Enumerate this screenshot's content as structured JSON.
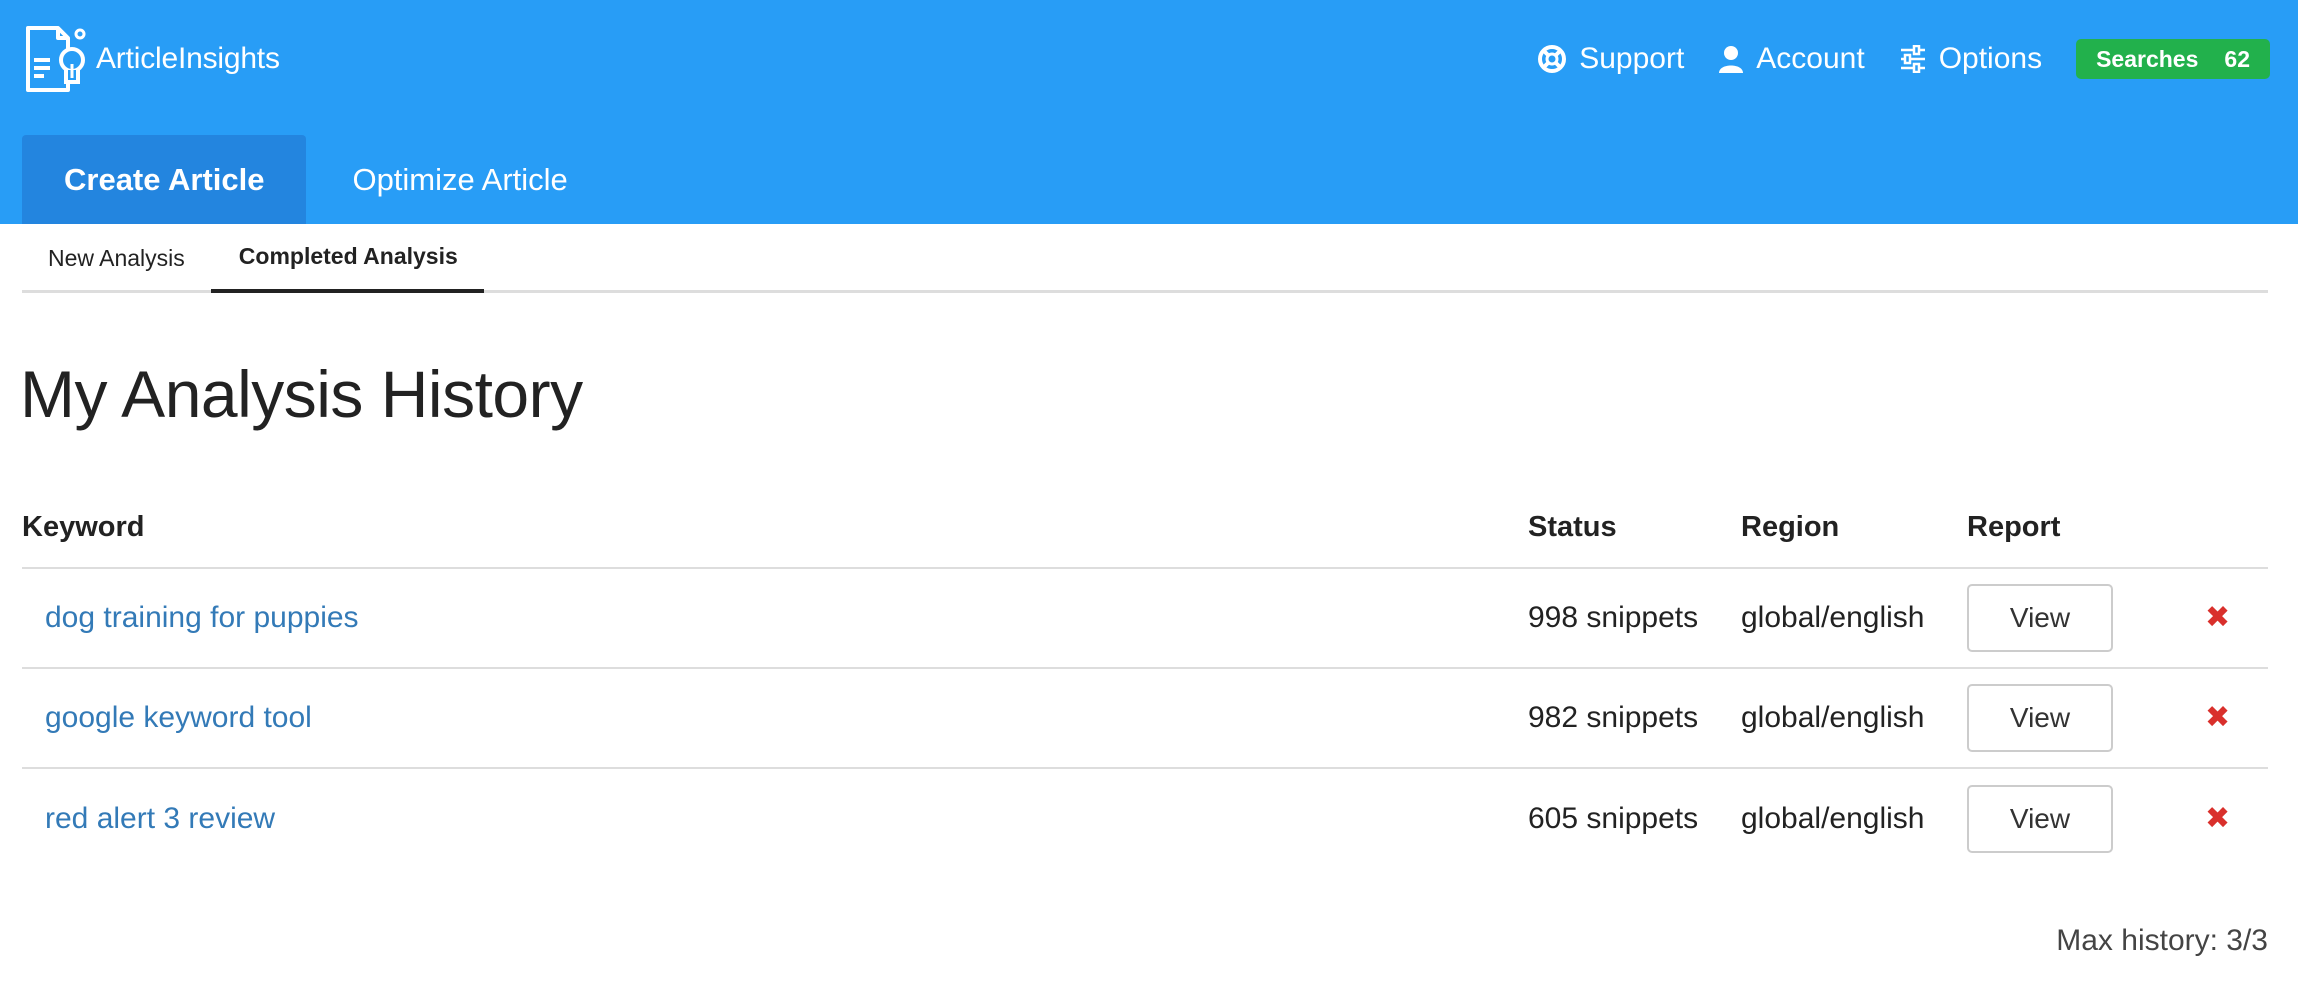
{
  "brand": {
    "name": "ArticleInsights",
    "logo_icon": "article-lightbulb-icon"
  },
  "topnav": {
    "support": {
      "label": "Support",
      "icon": "lifebuoy-icon"
    },
    "account": {
      "label": "Account",
      "icon": "user-icon"
    },
    "options": {
      "label": "Options",
      "icon": "sliders-icon"
    },
    "searches": {
      "label": "Searches",
      "count": "62"
    }
  },
  "main_tabs": [
    {
      "label": "Create Article",
      "active": true
    },
    {
      "label": "Optimize Article",
      "active": false
    }
  ],
  "sub_tabs": [
    {
      "label": "New Analysis",
      "active": false
    },
    {
      "label": "Completed Analysis",
      "active": true
    }
  ],
  "page_title": "My Analysis History",
  "table": {
    "headers": {
      "keyword": "Keyword",
      "status": "Status",
      "region": "Region",
      "report": "Report"
    },
    "rows": [
      {
        "keyword": "dog training for puppies",
        "status": "998 snippets",
        "region": "global/english",
        "report_label": "View",
        "delete_icon": "✖"
      },
      {
        "keyword": "google keyword tool",
        "status": "982 snippets",
        "region": "global/english",
        "report_label": "View",
        "delete_icon": "✖"
      },
      {
        "keyword": "red alert 3 review",
        "status": "605 snippets",
        "region": "global/english",
        "report_label": "View",
        "delete_icon": "✖"
      }
    ]
  },
  "footer": {
    "max_history": "Max history: 3/3"
  },
  "colors": {
    "header_bg": "#289df6",
    "active_tab_bg": "#2385df",
    "searches_badge": "#22b14c",
    "link": "#337ab7",
    "delete": "#d9302c"
  }
}
